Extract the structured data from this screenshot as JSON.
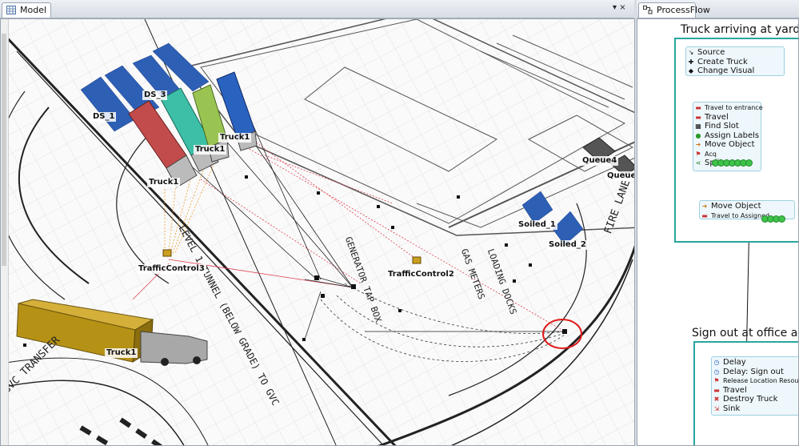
{
  "tabs": {
    "model": "Model",
    "processflow": "ProcessFlow",
    "model_controls": "▾ ×"
  },
  "model": {
    "labels": {
      "ds3": "DS_3",
      "ds1": "DS_1",
      "truck_a": "Truck1",
      "truck_b": "Truck1",
      "truck_c": "Truck1",
      "truck_d": "Truck1",
      "queue4": "Queue4",
      "queue_cut": "Queue",
      "soiled1": "Soiled_1",
      "soiled2": "Soiled_2",
      "tc3": "TrafficControl3",
      "tc2": "TrafficControl2"
    },
    "ground_text": {
      "tunnel": "LEVEL 1 TUNNEL (BELOW GRADE) TO GVC",
      "general": "GENERATOR TAP BOX",
      "meters": "GAS METERS",
      "loading": "LOADING DOCKS",
      "fire": "FIRE LANE",
      "transfer": "GVC TRANSFER"
    }
  },
  "processflow": {
    "group1_title": "Truck arriving at yard",
    "group2_title": "Sign out at office and",
    "block1": [
      "Source",
      "Create Truck",
      "Change Visual"
    ],
    "block2": [
      "Travel to entrance",
      "Travel",
      "Find Slot",
      "Assign Labels",
      "Move Object",
      "Acq",
      "Split"
    ],
    "block3": [
      "Move Object",
      "Travel to Assigned"
    ],
    "block4": [
      "Delay",
      "Delay: Sign out",
      "Release Location Resource",
      "Travel",
      "Destroy Truck",
      "Sink"
    ],
    "colors": {
      "group_border": "#2aa5a0",
      "token": "#3fc34a",
      "block_bg": "#eef7fb"
    }
  }
}
